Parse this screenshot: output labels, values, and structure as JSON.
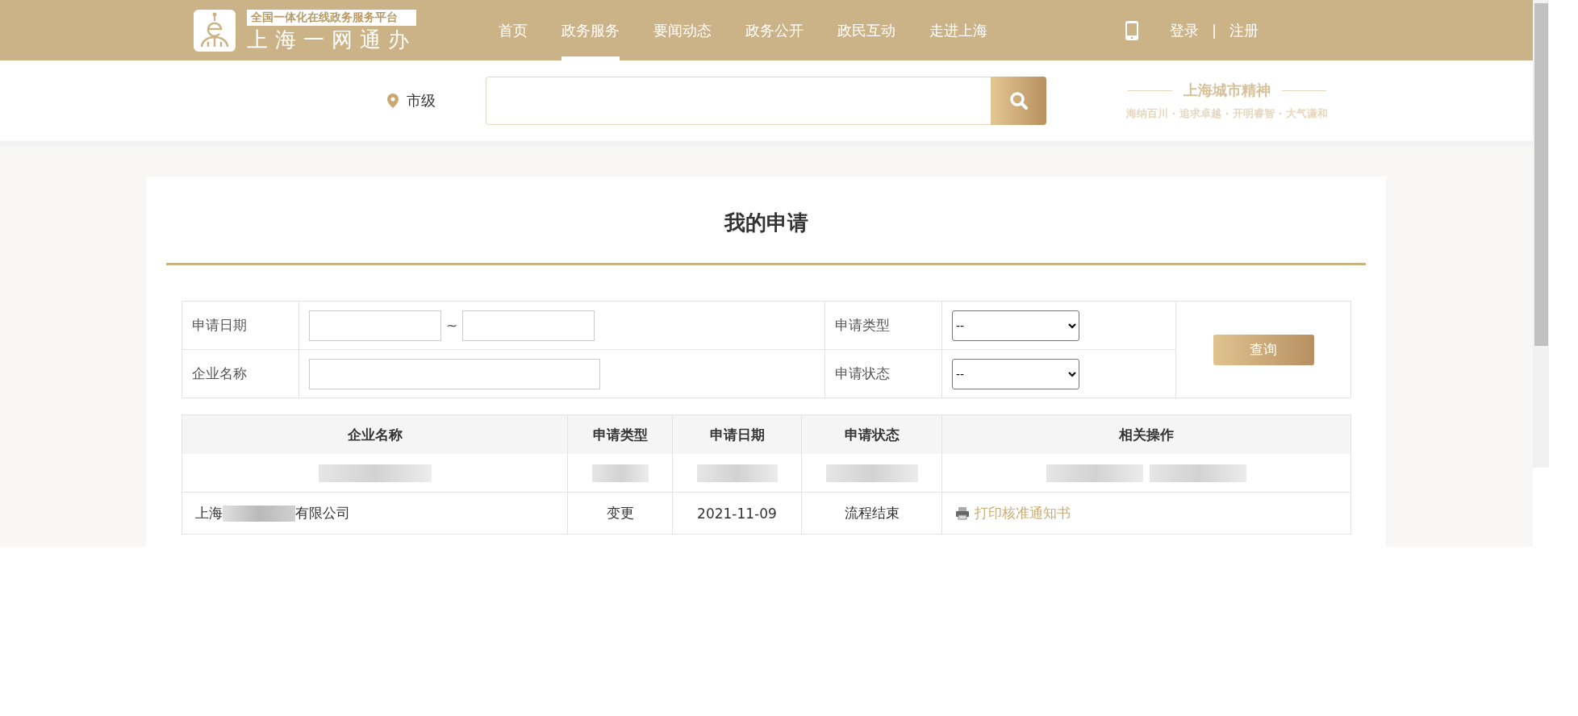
{
  "header": {
    "logo_tagline": "全国一体化在线政务服务平台",
    "logo_title": "上海一网通办",
    "nav": [
      {
        "label": "首页",
        "selected": false
      },
      {
        "label": "政务服务",
        "selected": true
      },
      {
        "label": "要闻动态",
        "selected": false
      },
      {
        "label": "政务公开",
        "selected": false
      },
      {
        "label": "政民互动",
        "selected": false
      },
      {
        "label": "走进上海",
        "selected": false
      }
    ],
    "login": "登录",
    "separator": "|",
    "register": "注册"
  },
  "search": {
    "location": "市级",
    "slogan_title": "上海城市精神",
    "slogan_text": "海纳百川 · 追求卓越 · 开明睿智 · 大气谦和"
  },
  "page_title": "我的申请",
  "filters": {
    "date_label": "申请日期",
    "date_separator": "~",
    "type_label": "申请类型",
    "type_value": "--",
    "company_label": "企业名称",
    "status_label": "申请状态",
    "status_value": "--",
    "query_button": "查询"
  },
  "table": {
    "columns": [
      "企业名称",
      "申请类型",
      "申请日期",
      "申请状态",
      "相关操作"
    ],
    "rows": [
      {
        "kind": "redacted"
      },
      {
        "kind": "record",
        "company_start": "上海",
        "company_end": "有限公司",
        "type": "变更",
        "date": "2021-11-09",
        "status": "流程结束",
        "action": "打印核准通知书"
      }
    ]
  }
}
